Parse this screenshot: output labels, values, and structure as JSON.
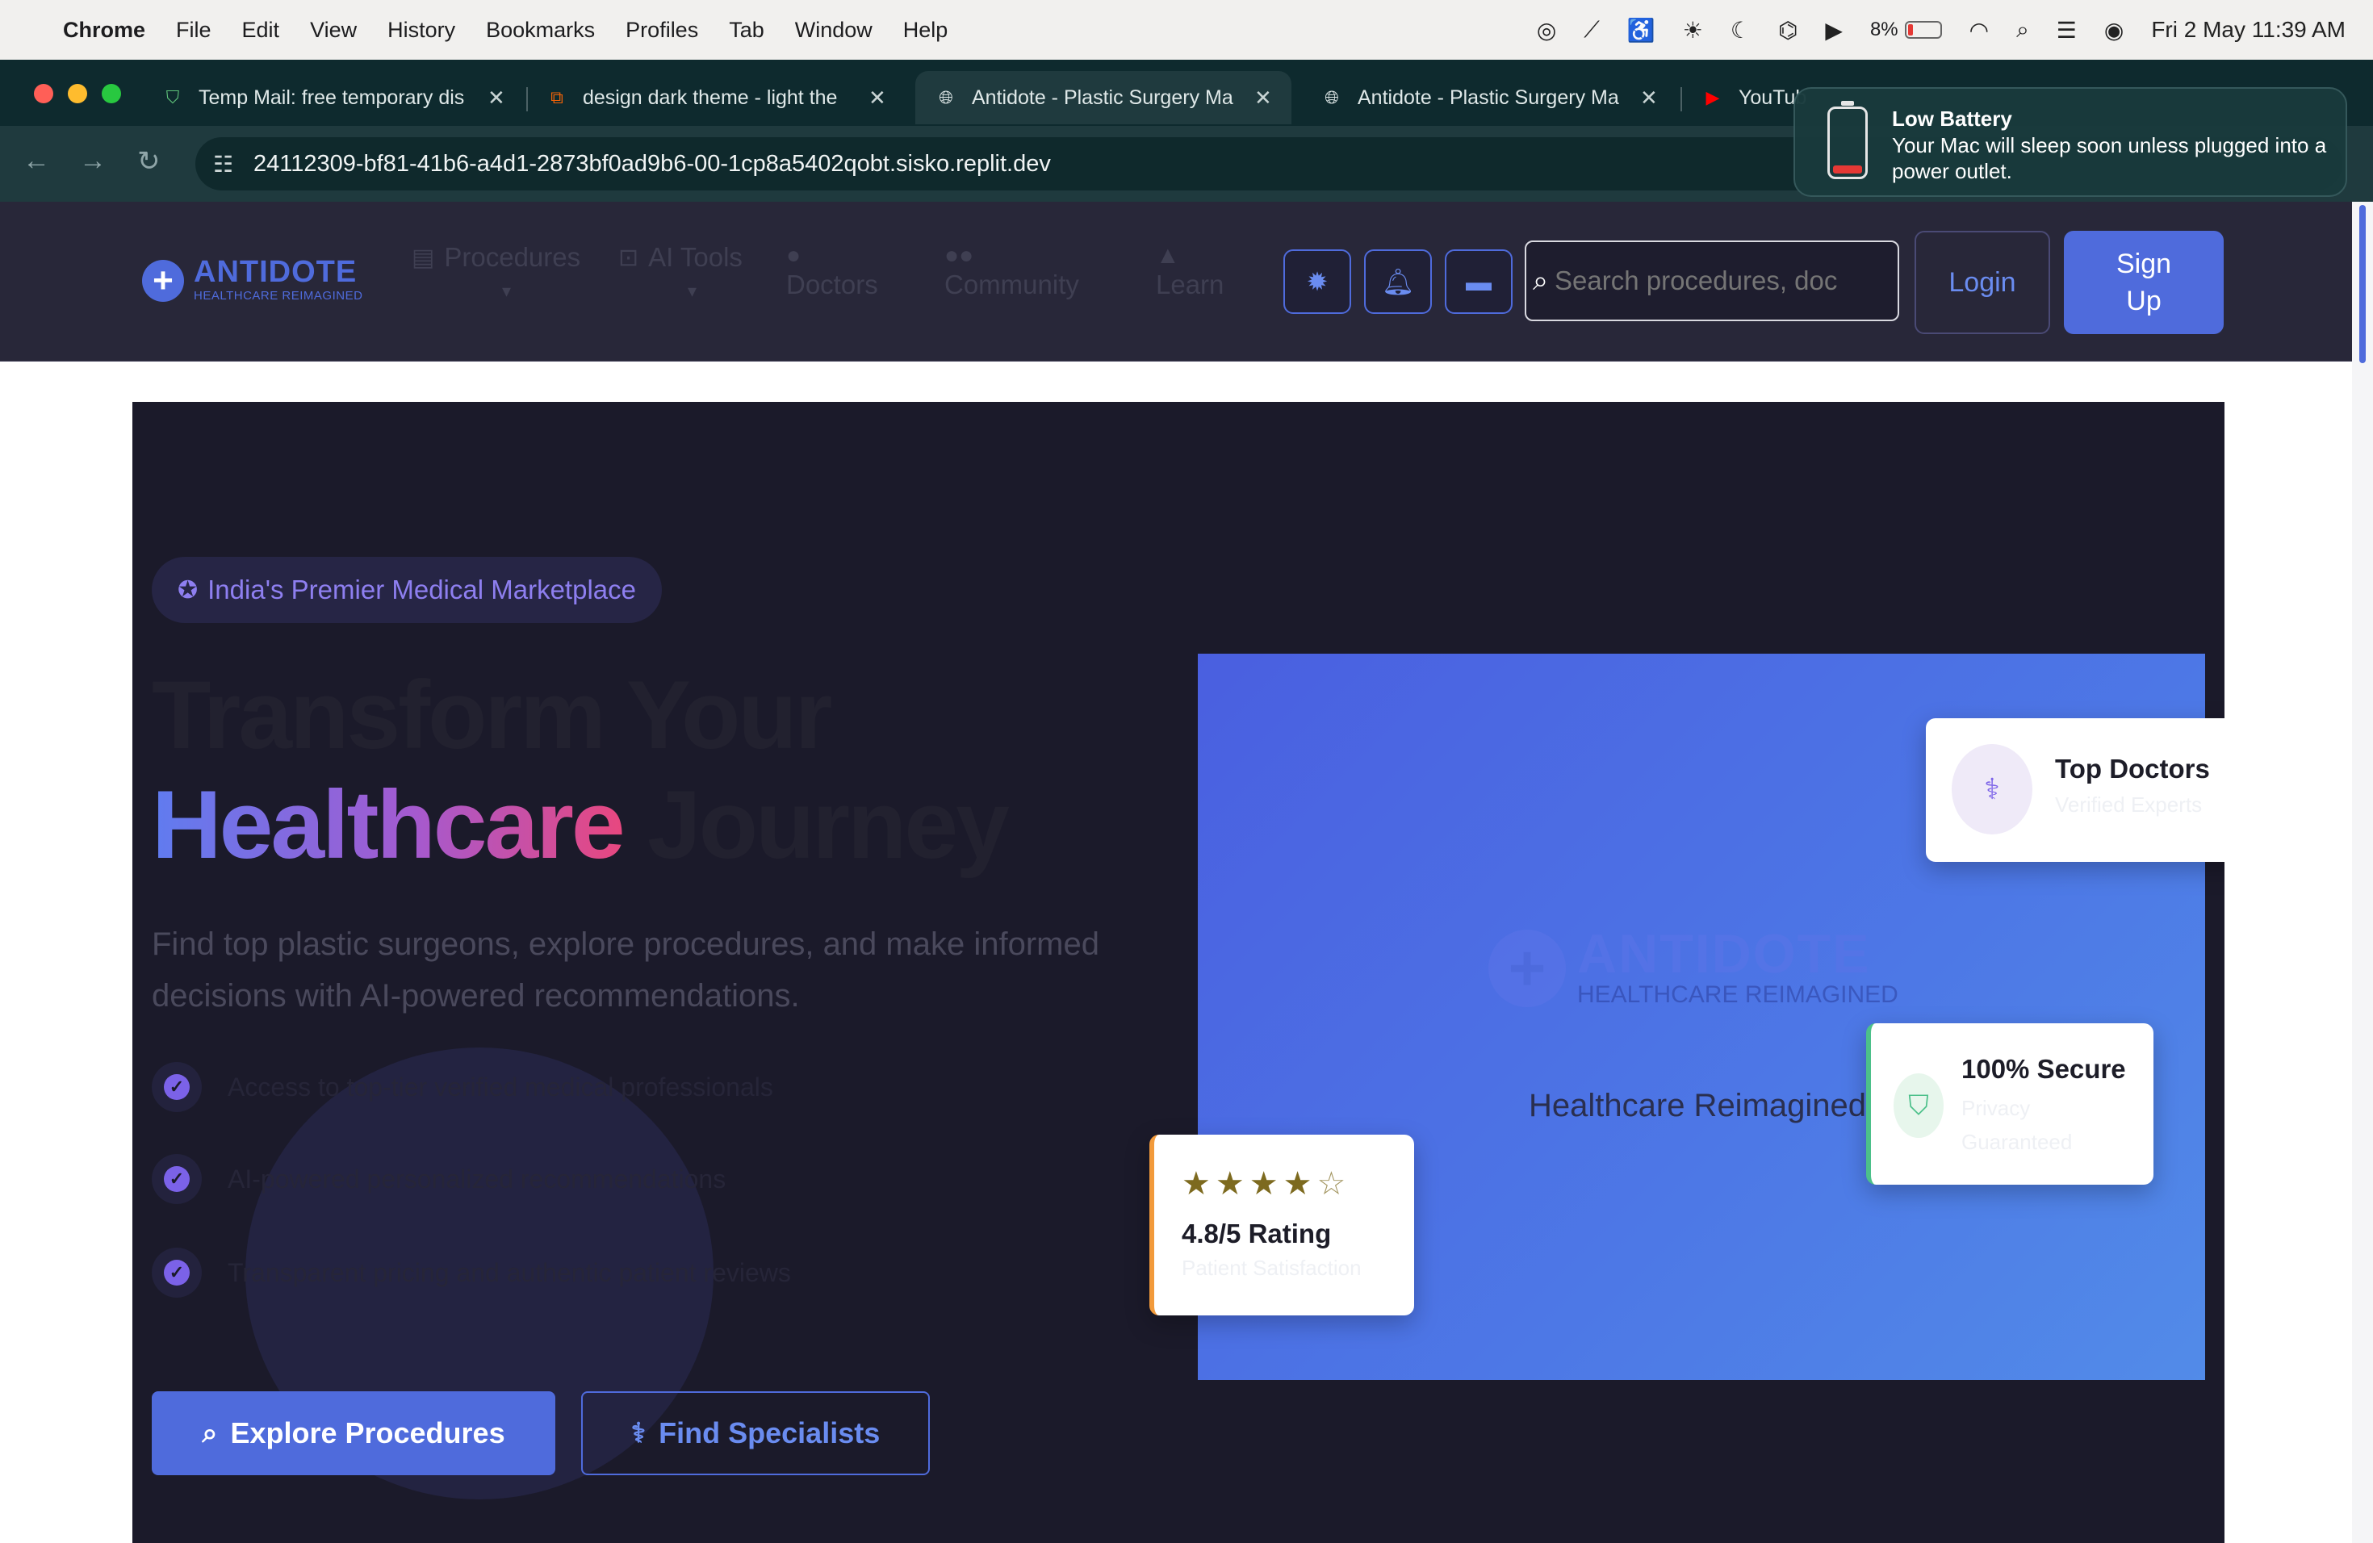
{
  "menubar": {
    "app": "Chrome",
    "items": [
      "File",
      "Edit",
      "View",
      "History",
      "Bookmarks",
      "Profiles",
      "Tab",
      "Window",
      "Help"
    ],
    "battery_percent": "8%",
    "datetime": "Fri 2 May  11:39 AM"
  },
  "tabs": [
    {
      "title": "Temp Mail: free temporary dis",
      "favicon": "shield-icon",
      "favicon_color": "#5fc27a"
    },
    {
      "title": "design dark theme - light the",
      "favicon": "replit-icon",
      "favicon_color": "#f26207"
    },
    {
      "title": "Antidote - Plastic Surgery Ma",
      "favicon": "globe-icon",
      "active": true
    },
    {
      "title": "Antidote - Plastic Surgery Ma",
      "favicon": "globe-icon"
    },
    {
      "title": "YouTub",
      "favicon": "youtube-icon",
      "favicon_color": "#ff0000"
    }
  ],
  "address_bar": {
    "url": "24112309-bf81-41b6-a4d1-2873bf0ad9b6-00-1cp8a5402qobt.sisko.replit.dev"
  },
  "notification": {
    "title": "Low Battery",
    "body": "Your Mac will sleep soon unless plugged into a power outlet."
  },
  "site": {
    "logo_name": "ANTIDOTE",
    "logo_tagline": "HEALTHCARE REIMAGINED",
    "nav": [
      "Procedures",
      "AI Tools",
      "Doctors",
      "Community",
      "Learn"
    ],
    "search_placeholder": "Search procedures, doc",
    "login_label": "Login",
    "signup_label": "Sign Up",
    "accent_color": "#4f6bdc"
  },
  "hero": {
    "badge": "India's Premier Medical Marketplace",
    "heading_line1": "Transform Your",
    "heading_highlight": "Healthcare",
    "heading_rest": " Journey",
    "lead": "Find top plastic surgeons, explore procedures, and make informed decisions with AI-powered recommendations.",
    "features": [
      "Access to top-tier verified medical professionals",
      "AI-powered personalized recommendations",
      "Transparent pricing and authentic patient reviews"
    ],
    "explore_label": "Explore Procedures",
    "find_label": "Find Specialists"
  },
  "panel": {
    "watermark_name": "ANTIDOTE",
    "watermark_tagline": "HEALTHCARE REIMAGINED",
    "tagline": "Healthcare Reimagined"
  },
  "cards": {
    "docs_title": "Top Doctors",
    "docs_sub": "Verified Experts",
    "secure_title": "100% Secure",
    "secure_sub": "Privacy Guaranteed",
    "rating_title": "4.8/5 Rating",
    "rating_sub": "Patient Satisfaction",
    "rating_value": 4.5
  }
}
